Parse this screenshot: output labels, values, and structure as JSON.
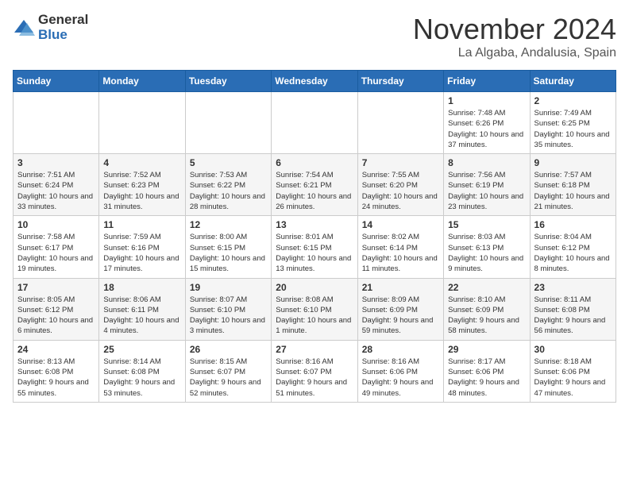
{
  "logo": {
    "general": "General",
    "blue": "Blue"
  },
  "title": "November 2024",
  "location": "La Algaba, Andalusia, Spain",
  "weekdays": [
    "Sunday",
    "Monday",
    "Tuesday",
    "Wednesday",
    "Thursday",
    "Friday",
    "Saturday"
  ],
  "weeks": [
    [
      {
        "day": "",
        "info": ""
      },
      {
        "day": "",
        "info": ""
      },
      {
        "day": "",
        "info": ""
      },
      {
        "day": "",
        "info": ""
      },
      {
        "day": "",
        "info": ""
      },
      {
        "day": "1",
        "info": "Sunrise: 7:48 AM\nSunset: 6:26 PM\nDaylight: 10 hours and 37 minutes."
      },
      {
        "day": "2",
        "info": "Sunrise: 7:49 AM\nSunset: 6:25 PM\nDaylight: 10 hours and 35 minutes."
      }
    ],
    [
      {
        "day": "3",
        "info": "Sunrise: 7:51 AM\nSunset: 6:24 PM\nDaylight: 10 hours and 33 minutes."
      },
      {
        "day": "4",
        "info": "Sunrise: 7:52 AM\nSunset: 6:23 PM\nDaylight: 10 hours and 31 minutes."
      },
      {
        "day": "5",
        "info": "Sunrise: 7:53 AM\nSunset: 6:22 PM\nDaylight: 10 hours and 28 minutes."
      },
      {
        "day": "6",
        "info": "Sunrise: 7:54 AM\nSunset: 6:21 PM\nDaylight: 10 hours and 26 minutes."
      },
      {
        "day": "7",
        "info": "Sunrise: 7:55 AM\nSunset: 6:20 PM\nDaylight: 10 hours and 24 minutes."
      },
      {
        "day": "8",
        "info": "Sunrise: 7:56 AM\nSunset: 6:19 PM\nDaylight: 10 hours and 23 minutes."
      },
      {
        "day": "9",
        "info": "Sunrise: 7:57 AM\nSunset: 6:18 PM\nDaylight: 10 hours and 21 minutes."
      }
    ],
    [
      {
        "day": "10",
        "info": "Sunrise: 7:58 AM\nSunset: 6:17 PM\nDaylight: 10 hours and 19 minutes."
      },
      {
        "day": "11",
        "info": "Sunrise: 7:59 AM\nSunset: 6:16 PM\nDaylight: 10 hours and 17 minutes."
      },
      {
        "day": "12",
        "info": "Sunrise: 8:00 AM\nSunset: 6:15 PM\nDaylight: 10 hours and 15 minutes."
      },
      {
        "day": "13",
        "info": "Sunrise: 8:01 AM\nSunset: 6:15 PM\nDaylight: 10 hours and 13 minutes."
      },
      {
        "day": "14",
        "info": "Sunrise: 8:02 AM\nSunset: 6:14 PM\nDaylight: 10 hours and 11 minutes."
      },
      {
        "day": "15",
        "info": "Sunrise: 8:03 AM\nSunset: 6:13 PM\nDaylight: 10 hours and 9 minutes."
      },
      {
        "day": "16",
        "info": "Sunrise: 8:04 AM\nSunset: 6:12 PM\nDaylight: 10 hours and 8 minutes."
      }
    ],
    [
      {
        "day": "17",
        "info": "Sunrise: 8:05 AM\nSunset: 6:12 PM\nDaylight: 10 hours and 6 minutes."
      },
      {
        "day": "18",
        "info": "Sunrise: 8:06 AM\nSunset: 6:11 PM\nDaylight: 10 hours and 4 minutes."
      },
      {
        "day": "19",
        "info": "Sunrise: 8:07 AM\nSunset: 6:10 PM\nDaylight: 10 hours and 3 minutes."
      },
      {
        "day": "20",
        "info": "Sunrise: 8:08 AM\nSunset: 6:10 PM\nDaylight: 10 hours and 1 minute."
      },
      {
        "day": "21",
        "info": "Sunrise: 8:09 AM\nSunset: 6:09 PM\nDaylight: 9 hours and 59 minutes."
      },
      {
        "day": "22",
        "info": "Sunrise: 8:10 AM\nSunset: 6:09 PM\nDaylight: 9 hours and 58 minutes."
      },
      {
        "day": "23",
        "info": "Sunrise: 8:11 AM\nSunset: 6:08 PM\nDaylight: 9 hours and 56 minutes."
      }
    ],
    [
      {
        "day": "24",
        "info": "Sunrise: 8:13 AM\nSunset: 6:08 PM\nDaylight: 9 hours and 55 minutes."
      },
      {
        "day": "25",
        "info": "Sunrise: 8:14 AM\nSunset: 6:08 PM\nDaylight: 9 hours and 53 minutes."
      },
      {
        "day": "26",
        "info": "Sunrise: 8:15 AM\nSunset: 6:07 PM\nDaylight: 9 hours and 52 minutes."
      },
      {
        "day": "27",
        "info": "Sunrise: 8:16 AM\nSunset: 6:07 PM\nDaylight: 9 hours and 51 minutes."
      },
      {
        "day": "28",
        "info": "Sunrise: 8:16 AM\nSunset: 6:06 PM\nDaylight: 9 hours and 49 minutes."
      },
      {
        "day": "29",
        "info": "Sunrise: 8:17 AM\nSunset: 6:06 PM\nDaylight: 9 hours and 48 minutes."
      },
      {
        "day": "30",
        "info": "Sunrise: 8:18 AM\nSunset: 6:06 PM\nDaylight: 9 hours and 47 minutes."
      }
    ]
  ]
}
